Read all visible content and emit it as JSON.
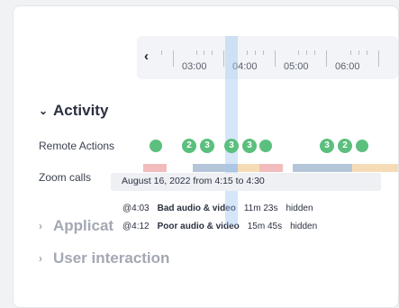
{
  "timeline": {
    "prev_label": "‹",
    "labels": [
      "03:00",
      "04:00",
      "05:00",
      "06:00"
    ]
  },
  "activity": {
    "title": "Activity",
    "chevron": "⌄"
  },
  "remote_actions": {
    "label": "Remote Actions",
    "dots": [
      "",
      "2",
      "3",
      "3",
      "3",
      "",
      "3",
      "2",
      ""
    ]
  },
  "zoom_calls": {
    "label": "Zoom calls",
    "colors": {
      "red": "#f3bcbc",
      "blue": "#b6c6da",
      "orange": "#f6dcb6"
    }
  },
  "tooltip": {
    "text": "August 16, 2022 from 4:15 to 4:30"
  },
  "calls": [
    {
      "time": "@4:03",
      "quality": "Bad audio & video",
      "duration": "11m 23s",
      "visibility": "hidden"
    },
    {
      "time": "@4:12",
      "quality": "Poor audio & video",
      "duration": "15m 45s",
      "visibility": "hidden"
    }
  ],
  "applications": {
    "title": "Applicat",
    "chevron": "›"
  },
  "user_interaction": {
    "title": "User interaction",
    "chevron": "›"
  }
}
